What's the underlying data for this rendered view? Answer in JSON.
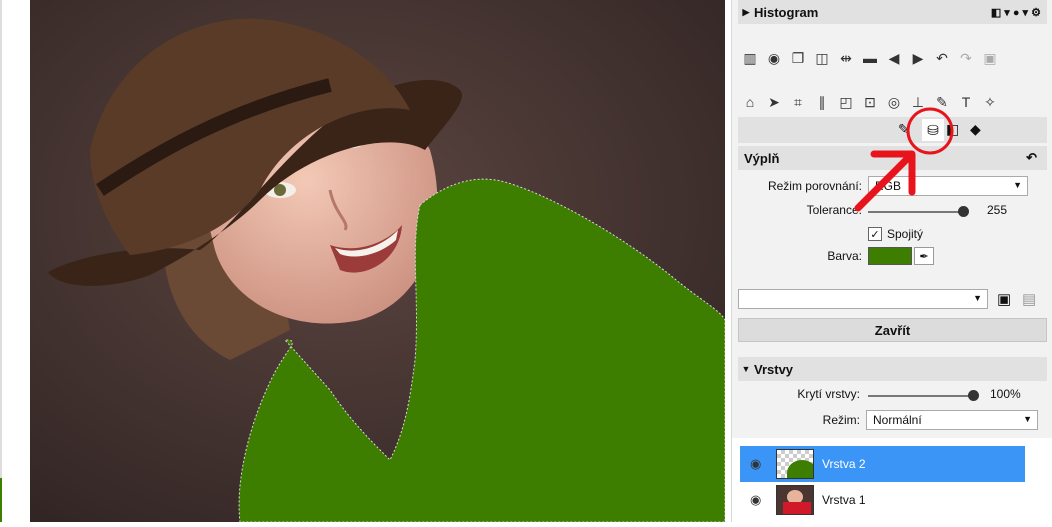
{
  "colors": {
    "fill_green": "#3d7d00",
    "accent_blue": "#3b95f7",
    "annotation_red": "#e8141c"
  },
  "histogram": {
    "title": "Histogram"
  },
  "toolbar_icons": [
    "histogram-icon",
    "lens-icon",
    "copy-icon",
    "compare-icon",
    "flip-icon",
    "folder-icon",
    "back-icon",
    "forward-icon",
    "undo-icon",
    "redo-icon",
    "image-icon"
  ],
  "tools_icons": [
    "home-icon",
    "select-icon",
    "crop-icon",
    "perspective-icon",
    "transform-icon",
    "text-box-icon",
    "eye-icon",
    "levels-icon",
    "brush-icon",
    "text-icon",
    "effects-icon"
  ],
  "subtools_icons": [
    "brush-sub-icon",
    "fill-bucket-icon",
    "gradient-icon",
    "eraser-icon"
  ],
  "fill": {
    "title": "Výplň",
    "mode_label": "Režim porovnání:",
    "mode_value": "RGB",
    "tolerance_label": "Tolerance:",
    "tolerance_value": "255",
    "contiguous_label": "Spojitý",
    "contiguous_checked": "✓",
    "color_label": "Barva:"
  },
  "preset_select_value": "",
  "close_button": "Zavřít",
  "layers": {
    "title": "Vrstvy",
    "opacity_label": "Krytí vrstvy:",
    "opacity_value": "100%",
    "mode_label": "Režim:",
    "mode_value": "Normální",
    "items": [
      {
        "name": "Vrstva 2"
      },
      {
        "name": "Vrstva 1"
      }
    ]
  }
}
